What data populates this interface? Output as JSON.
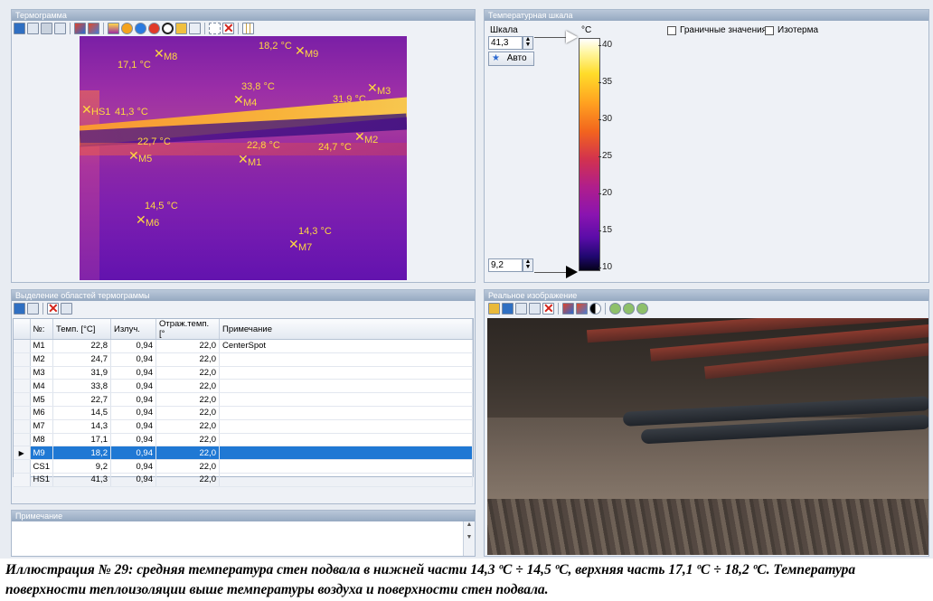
{
  "panels": {
    "thermogram": "Термограмма",
    "scale": "Температурная шкала",
    "regions": "Выделение областей термограммы",
    "note": "Примечание",
    "real_image": "Реальное изображение"
  },
  "markers": [
    {
      "id": "M8",
      "temp": "17,1 °C"
    },
    {
      "id": "M9",
      "temp": "18,2 °C"
    },
    {
      "id": "M3",
      "temp": "31,9 °C"
    },
    {
      "id": "M4",
      "temp": "33,8 °C"
    },
    {
      "id": "HS1",
      "temp": "41,3 °C"
    },
    {
      "id": "M2",
      "temp": "24,7 °C"
    },
    {
      "id": "M5",
      "temp": "22,7 °C"
    },
    {
      "id": "M1",
      "temp": "22,8 °C"
    },
    {
      "id": "M6",
      "temp": "14,5 °C"
    },
    {
      "id": "M7",
      "temp": "14,3 °C"
    }
  ],
  "scale": {
    "label": "Шкала",
    "max_value": "41,3",
    "min_value": "9,2",
    "auto_button": "Авто",
    "unit": "°C",
    "ticks": [
      "40",
      "35",
      "30",
      "25",
      "20",
      "15",
      "10"
    ],
    "boundary_label": "Граничные значения",
    "isotherm_label": "Изотерма"
  },
  "table": {
    "columns": [
      "№:",
      "Темп. [°C]",
      "Излуч.",
      "Отраж.темп. [°",
      "Примечание"
    ],
    "rows": [
      {
        "n": "M1",
        "temp": "22,8",
        "emis": "0,94",
        "refl": "22,0",
        "note": "CenterSpot",
        "selected": false
      },
      {
        "n": "M2",
        "temp": "24,7",
        "emis": "0,94",
        "refl": "22,0",
        "note": "",
        "selected": false
      },
      {
        "n": "M3",
        "temp": "31,9",
        "emis": "0,94",
        "refl": "22,0",
        "note": "",
        "selected": false
      },
      {
        "n": "M4",
        "temp": "33,8",
        "emis": "0,94",
        "refl": "22,0",
        "note": "",
        "selected": false
      },
      {
        "n": "M5",
        "temp": "22,7",
        "emis": "0,94",
        "refl": "22,0",
        "note": "",
        "selected": false
      },
      {
        "n": "M6",
        "temp": "14,5",
        "emis": "0,94",
        "refl": "22,0",
        "note": "",
        "selected": false
      },
      {
        "n": "M7",
        "temp": "14,3",
        "emis": "0,94",
        "refl": "22,0",
        "note": "",
        "selected": false
      },
      {
        "n": "M8",
        "temp": "17,1",
        "emis": "0,94",
        "refl": "22,0",
        "note": "",
        "selected": false
      },
      {
        "n": "M9",
        "temp": "18,2",
        "emis": "0,94",
        "refl": "22,0",
        "note": "",
        "selected": true
      },
      {
        "n": "CS1",
        "temp": "9,2",
        "emis": "0,94",
        "refl": "22,0",
        "note": "",
        "selected": false
      },
      {
        "n": "HS1",
        "temp": "41,3",
        "emis": "0,94",
        "refl": "22,0",
        "note": "",
        "selected": false
      }
    ]
  },
  "caption": "Иллюстрация № 29: средняя температура стен подвала в нижней части 14,3 ºC ÷ 14,5 ºC, верхняя часть 17,1 ºC ÷ 18,2 ºC. Температура поверхности теплоизоляции выше температуры воздуха и поверхности стен подвала."
}
